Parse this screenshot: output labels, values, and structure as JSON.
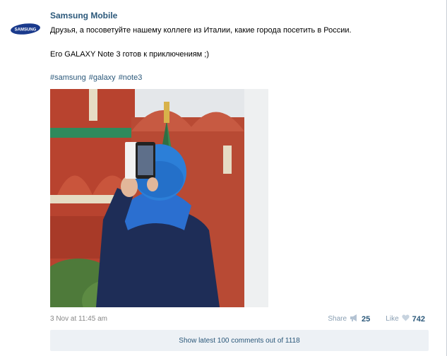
{
  "post": {
    "author": "Samsung Mobile",
    "logo_text": "SAMSUNG",
    "text_line1": "Друзья, а посоветуйте нашему коллеге из Италии, какие города посетить в России.",
    "text_line2": "Его GALAXY Note 3 готов к приключениям ;)",
    "hashtags": [
      "#samsung",
      "#galaxy",
      "#note3"
    ],
    "date": "3 Nov at 11:45 am",
    "share_label": "Share",
    "share_count": "25",
    "like_label": "Like",
    "like_count": "742",
    "comments_button": "Show latest 100 comments out of 1118"
  },
  "colors": {
    "link": "#2b587a",
    "comments_bg": "#edf1f5",
    "meta": "#888888"
  }
}
